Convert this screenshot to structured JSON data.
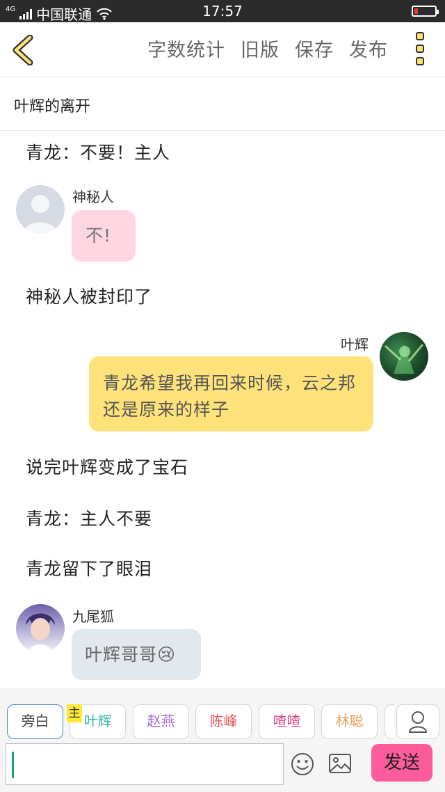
{
  "status_bar": {
    "carrier": "中国联通",
    "network": "4G",
    "time": "17:57"
  },
  "toolbar": {
    "back_icon": "chevron-left-icon",
    "actions": [
      "字数统计",
      "旧版",
      "保存",
      "发布"
    ],
    "more_icon": "three-dot-vertical-icon"
  },
  "story": {
    "title": "叶辉的离开"
  },
  "chat": {
    "narration_1": "青龙：不要！主人",
    "msg_1": {
      "name": "神秘人",
      "text": "不!"
    },
    "narration_2": "神秘人被封印了",
    "msg_2": {
      "name": "叶辉",
      "text": "青龙希望我再回来时候，云之邦还是原来的样子"
    },
    "narration_3": "说完叶辉变成了宝石",
    "narration_4": "青龙：主人不要",
    "narration_5": "青龙留下了眼泪",
    "msg_3": {
      "name": "九尾狐",
      "text": "叶辉哥哥",
      "emoji": "😢"
    }
  },
  "characters": {
    "items": [
      "旁白",
      "叶辉",
      "赵燕",
      "陈峰",
      "喳喳",
      "林聪"
    ],
    "main_tag": "主",
    "colors": {
      "旁白": "#444444",
      "叶辉": "#35b6a8",
      "赵燕": "#a86fd1",
      "陈峰": "#e05555",
      "喳喳": "#e0458a",
      "林聪": "#e9a060"
    }
  },
  "composer": {
    "send_label": "发送"
  },
  "colors": {
    "accent_yellow": "#ffe27a",
    "send_pink": "#ff5c9c",
    "pink_bubble": "#ffd6e2",
    "gray_bubble": "#e3e8ee"
  }
}
